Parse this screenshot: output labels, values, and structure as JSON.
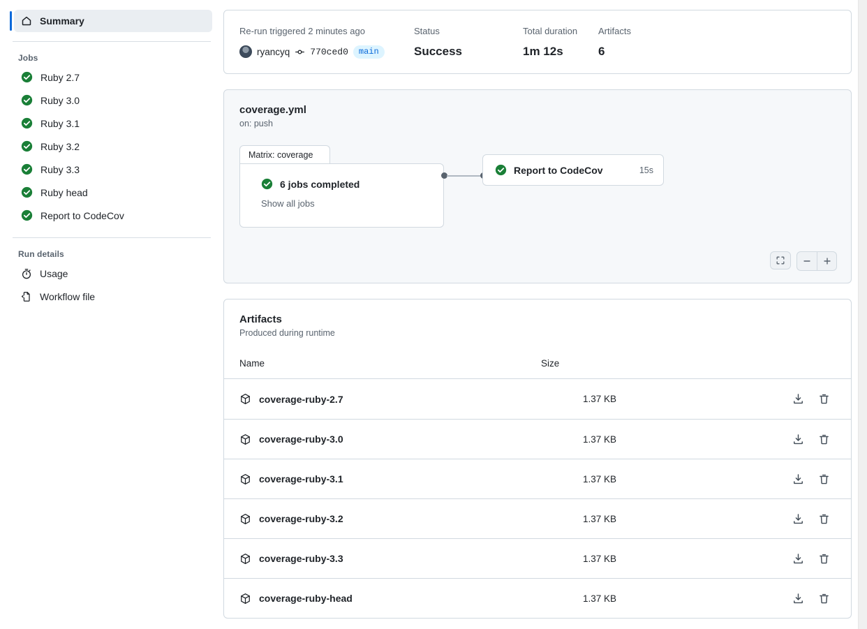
{
  "sidebar": {
    "summary": {
      "label": "Summary",
      "icon": "home-icon"
    },
    "jobs_heading": "Jobs",
    "jobs": [
      {
        "label": "Ruby 2.7",
        "status": "success"
      },
      {
        "label": "Ruby 3.0",
        "status": "success"
      },
      {
        "label": "Ruby 3.1",
        "status": "success"
      },
      {
        "label": "Ruby 3.2",
        "status": "success"
      },
      {
        "label": "Ruby 3.3",
        "status": "success"
      },
      {
        "label": "Ruby head",
        "status": "success"
      },
      {
        "label": "Report to CodeCov",
        "status": "success"
      }
    ],
    "run_details_heading": "Run details",
    "run_details": [
      {
        "label": "Usage",
        "icon": "stopwatch-icon"
      },
      {
        "label": "Workflow file",
        "icon": "file-code-icon"
      }
    ]
  },
  "run_header": {
    "trigger_key": "Re-run triggered 2 minutes ago",
    "actor": "ryancyq",
    "commit_sha": "770ced0",
    "branch": "main",
    "status_key": "Status",
    "status_value": "Success",
    "duration_key": "Total duration",
    "duration_value": "1m 12s",
    "artifacts_key": "Artifacts",
    "artifacts_value": "6"
  },
  "workflow_graph": {
    "name": "coverage.yml",
    "trigger": "on: push",
    "matrix": {
      "tab_label": "Matrix: coverage",
      "jobs_completed": "6 jobs completed",
      "show_all": "Show all jobs"
    },
    "node": {
      "label": "Report to CodeCov",
      "duration": "15s"
    },
    "controls": {
      "fit": "fit-screen-icon",
      "zoom_out": "minus-icon",
      "zoom_in": "plus-icon"
    }
  },
  "artifacts": {
    "title": "Artifacts",
    "subtitle": "Produced during runtime",
    "columns": {
      "name": "Name",
      "size": "Size"
    },
    "rows": [
      {
        "name": "coverage-ruby-2.7",
        "size": "1.37 KB"
      },
      {
        "name": "coverage-ruby-3.0",
        "size": "1.37 KB"
      },
      {
        "name": "coverage-ruby-3.1",
        "size": "1.37 KB"
      },
      {
        "name": "coverage-ruby-3.2",
        "size": "1.37 KB"
      },
      {
        "name": "coverage-ruby-3.3",
        "size": "1.37 KB"
      },
      {
        "name": "coverage-ruby-head",
        "size": "1.37 KB"
      }
    ],
    "row_actions": {
      "download": "download-icon",
      "delete": "trash-icon"
    }
  },
  "colors": {
    "accent": "#0969da",
    "success": "#1a7f37",
    "border": "#d1d9e0",
    "muted_text": "#59636e",
    "graph_bg": "#f6f8fa"
  }
}
